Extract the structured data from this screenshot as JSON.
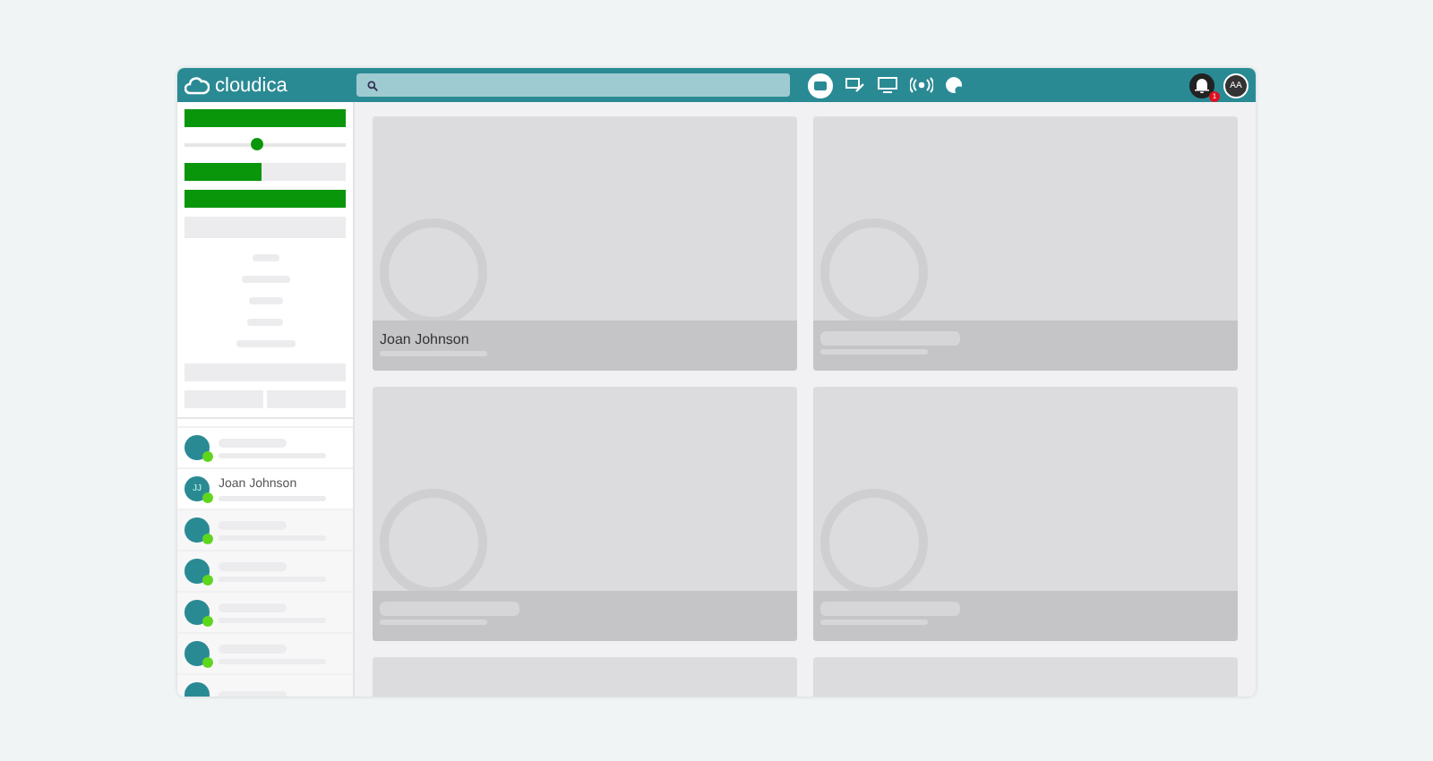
{
  "header": {
    "logo": "cloudica",
    "notification_count": "1",
    "avatar": "AA"
  },
  "controls": {
    "slider": {
      "level": 0.45
    },
    "progress": {
      "level": 0.48
    }
  },
  "contacts": [
    {
      "kind": "placeholder"
    },
    {
      "kind": "named",
      "name": "Joan Johnson",
      "initials": "JJ"
    },
    {
      "kind": "placeholder"
    },
    {
      "kind": "placeholder"
    },
    {
      "kind": "placeholder"
    },
    {
      "kind": "placeholder"
    },
    {
      "kind": "cut"
    }
  ],
  "tiles": [
    {
      "kind": "named",
      "name": "Joan Johnson"
    },
    {
      "kind": "placeholder"
    },
    {
      "kind": "placeholder"
    },
    {
      "kind": "placeholder"
    },
    {
      "kind": "cut"
    },
    {
      "kind": "cut"
    }
  ]
}
